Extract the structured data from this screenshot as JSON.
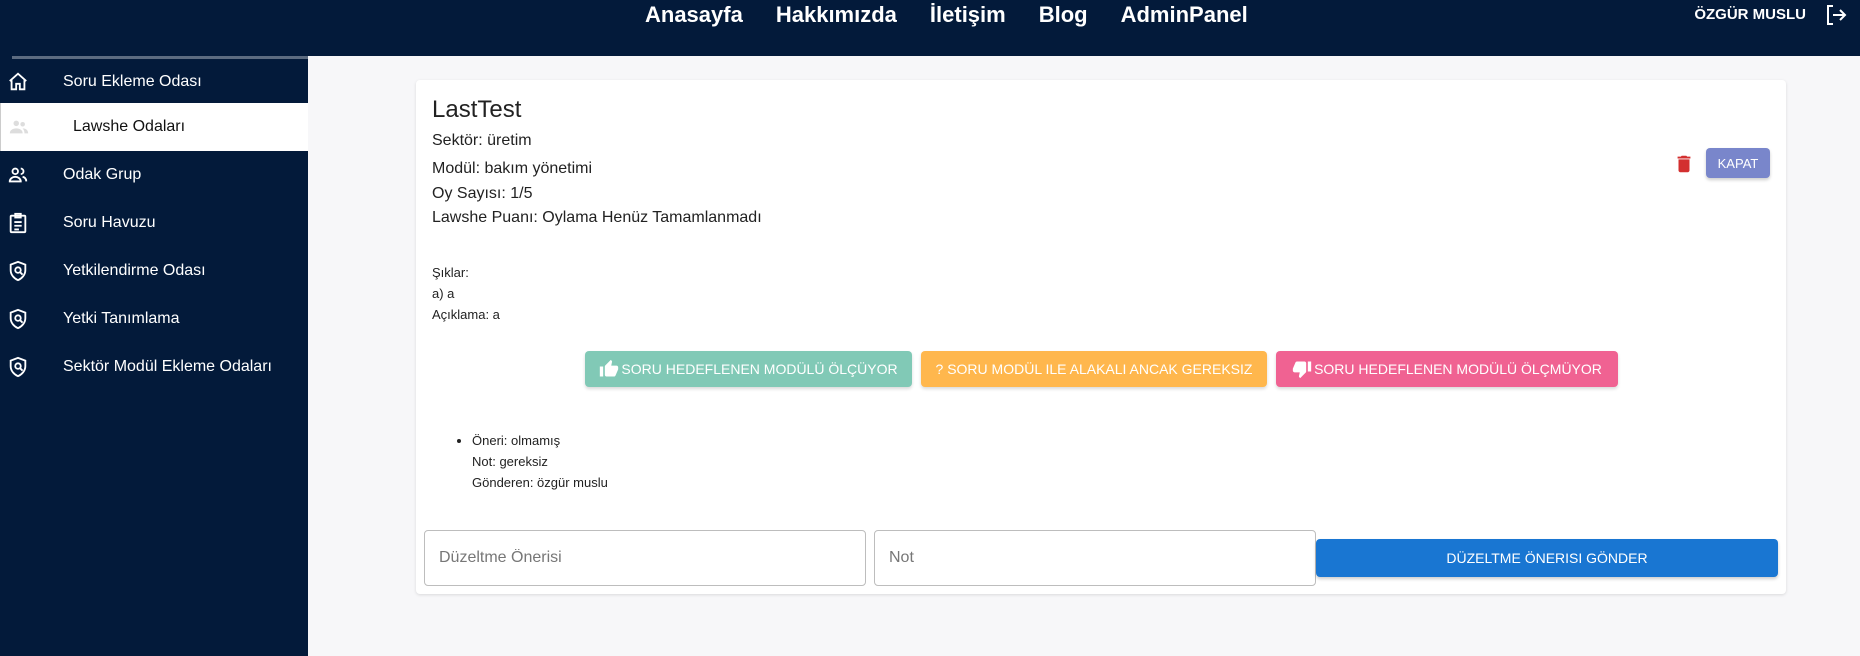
{
  "nav": {
    "links": [
      "Anasayfa",
      "Hakkımızda",
      "İletişim",
      "Blog",
      "AdminPanel"
    ],
    "user": "ÖZGÜR MUSLU",
    "logout_icon": "logout-icon"
  },
  "sidebar": {
    "items": [
      {
        "label": "Soru Ekleme Odası",
        "icon": "home-icon"
      },
      {
        "label": "Lawshe Odaları",
        "icon": "group-icon",
        "active": true
      },
      {
        "label": "Odak Grup",
        "icon": "group-icon"
      },
      {
        "label": "Soru Havuzu",
        "icon": "clipboard-icon"
      },
      {
        "label": "Yetkilendirme Odası",
        "icon": "shield-icon"
      },
      {
        "label": "Yetki Tanımlama",
        "icon": "shield-icon"
      },
      {
        "label": "Sektör Modül Ekleme Odaları",
        "icon": "shield-icon"
      }
    ]
  },
  "question": {
    "title": "LastTest",
    "sector": "Sektör: üretim",
    "module": "Modül: bakım yönetimi",
    "vote_count": "Oy Sayısı: 1/5",
    "lawshe_score": "Lawshe Puanı: Oylama Henüz Tamamlanmadı",
    "choices_label": "Şıklar:",
    "choice_a": "a) a",
    "explanation": "Açıklama: a",
    "close_label": "KAPAT"
  },
  "votes": {
    "yes": "SORU HEDEFLENEN MODÜLÜ ÖLÇÜYOR",
    "neutral": "? SORU MODÜL ILE ALAKALI ANCAK GEREKSIZ",
    "no": "SORU HEDEFLENEN MODÜLÜ ÖLÇMÜYOR"
  },
  "suggestion": {
    "oneri": "Öneri: olmamış",
    "not": "Not: gereksiz",
    "sender": "Gönderen: özgür muslu"
  },
  "form": {
    "suggestion_placeholder": "Düzeltme Önerisi",
    "note_placeholder": "Not",
    "send_label": "DÜZELTME ÖNERISI GÖNDER"
  },
  "colors": {
    "navbar": "#031a3a",
    "yes": "#81c9b6",
    "neutral": "#ffb74d",
    "no": "#f06292",
    "primary": "#1976d2",
    "close": "#7986cb",
    "delete": "#d32f2f"
  }
}
